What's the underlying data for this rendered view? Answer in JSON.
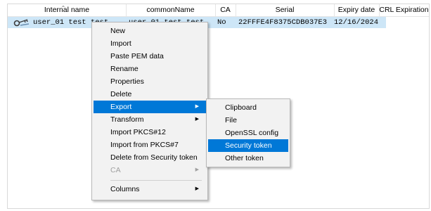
{
  "columns": [
    "Internal name",
    "commonName",
    "CA",
    "Serial",
    "Expiry date",
    "CRL Expiration"
  ],
  "row": {
    "internal_name": "user_01 test test",
    "common_name": "user_01 test test",
    "ca": "No",
    "serial": "22FFFE4F8375CDB037E3",
    "expiry": "12/16/2024"
  },
  "context_menu": {
    "items": [
      "New",
      "Import",
      "Paste PEM data",
      "Rename",
      "Properties",
      "Delete",
      "Export",
      "Transform",
      "Import PKCS#12",
      "Import from PKCS#7",
      "Delete from Security token",
      "CA",
      "Columns"
    ],
    "highlighted": "Export",
    "disabled": [
      "CA"
    ],
    "submenu_arrows": [
      "Export",
      "Transform",
      "CA",
      "Columns"
    ]
  },
  "export_submenu": {
    "items": [
      "Clipboard",
      "File",
      "OpenSSL config",
      "Security token",
      "Other token"
    ],
    "highlighted": "Security token"
  },
  "colors": {
    "selection": "#cde6f7",
    "highlight": "#0078d7",
    "menu_bg": "#f2f2f2"
  },
  "icons": {
    "row": "key-certificate-icon",
    "sort": "sort-up-icon",
    "submenu": "chevron-right-icon"
  }
}
